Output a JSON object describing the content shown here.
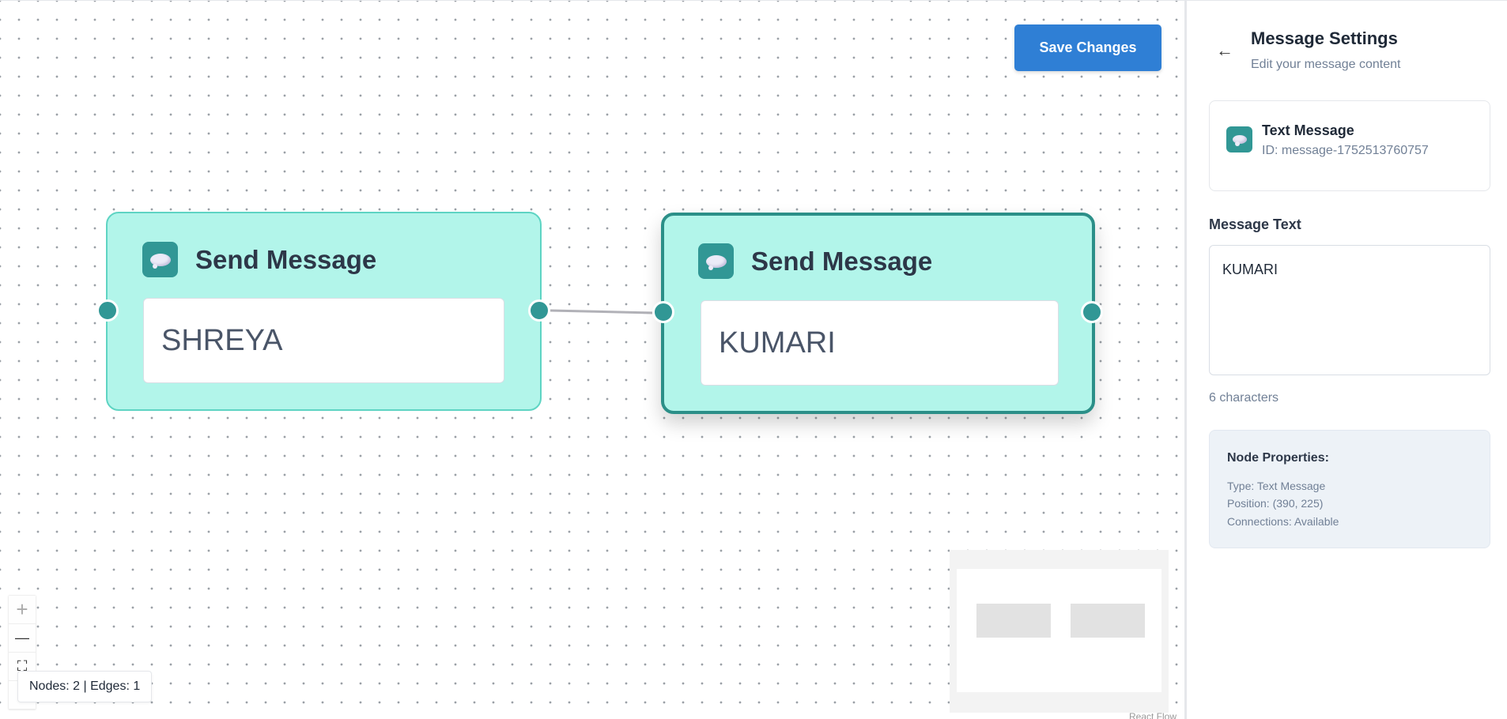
{
  "canvas": {
    "save_button": "Save Changes",
    "nodes": [
      {
        "title": "Send Message",
        "message": "SHREYA",
        "selected": false
      },
      {
        "title": "Send Message",
        "message": "KUMARI",
        "selected": true
      }
    ],
    "stats": "Nodes: 2 | Edges: 1",
    "controls": {
      "zoom_in": "+",
      "zoom_out": "—",
      "fit": "⛶",
      "lock": "🔒"
    },
    "attribution": "React Flow"
  },
  "panel": {
    "back_arrow": "←",
    "title": "Message Settings",
    "subtitle": "Edit your message content",
    "card": {
      "title": "Text Message",
      "id": "ID: message-1752513760757"
    },
    "field_label": "Message Text",
    "textarea_value": "KUMARI",
    "char_count": "6 characters",
    "properties": {
      "title": "Node Properties:",
      "type": "Type: Text Message",
      "position": "Position: (390, 225)",
      "connections": "Connections: Available"
    }
  },
  "colors": {
    "accent": "#319795",
    "node_bg": "#b2f5ea",
    "save_button": "#2f7fd5"
  },
  "icons": [
    "speech-bubble-icon",
    "back-arrow-icon",
    "zoom-in-icon",
    "zoom-out-icon",
    "fit-view-icon",
    "lock-icon"
  ]
}
